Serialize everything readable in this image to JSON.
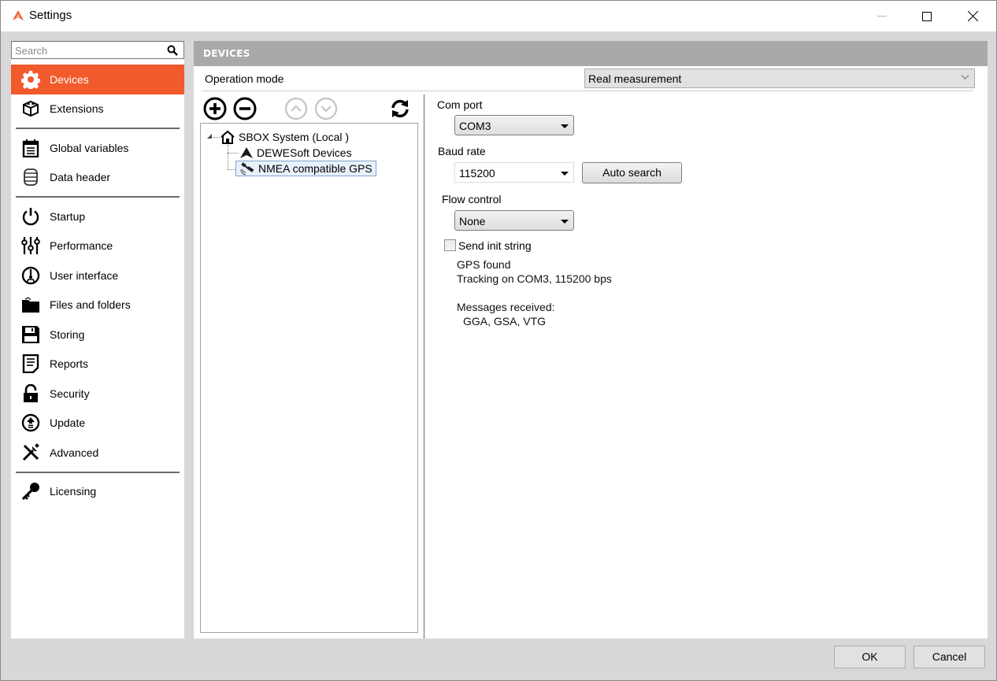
{
  "window": {
    "title": "Settings",
    "controls": {
      "minimize": "minimize",
      "maximize": "maximize",
      "close": "close"
    }
  },
  "sidebar": {
    "search": {
      "placeholder": "Search",
      "value": ""
    },
    "groups": [
      [
        {
          "label": "Devices",
          "icon": "gear-icon",
          "active": true
        },
        {
          "label": "Extensions",
          "icon": "lego-box-icon",
          "active": false
        }
      ],
      [
        {
          "label": "Global variables",
          "icon": "clipboard-icon",
          "active": false
        },
        {
          "label": "Data header",
          "icon": "database-icon",
          "active": false
        }
      ],
      [
        {
          "label": "Startup",
          "icon": "power-icon",
          "active": false
        },
        {
          "label": "Performance",
          "icon": "sliders-icon",
          "active": false
        },
        {
          "label": "User interface",
          "icon": "gauge-icon",
          "active": false
        },
        {
          "label": "Files and folders",
          "icon": "folder-icon",
          "active": false
        },
        {
          "label": "Storing",
          "icon": "floppy-disk-icon",
          "active": false
        },
        {
          "label": "Reports",
          "icon": "document-icon",
          "active": false
        },
        {
          "label": "Security",
          "icon": "lock-icon",
          "active": false
        },
        {
          "label": "Update",
          "icon": "upload-circle-icon",
          "active": false
        },
        {
          "label": "Advanced",
          "icon": "tools-icon",
          "active": false
        }
      ],
      [
        {
          "label": "Licensing",
          "icon": "key-icon",
          "active": false
        }
      ]
    ]
  },
  "main": {
    "section_title": "DEVICES",
    "operation_mode": {
      "label": "Operation mode",
      "value": "Real measurement"
    },
    "toolbar": {
      "add": "add-device",
      "remove": "remove-device",
      "move_up": "move-up",
      "move_down": "move-down",
      "refresh": "refresh"
    },
    "tree": {
      "root": {
        "label": "SBOX System (Local )",
        "icon": "home-icon",
        "expanded": true
      },
      "children": [
        {
          "label": "DEWESoft Devices",
          "icon": "dewesoft-logo-icon",
          "selected": false
        },
        {
          "label": "NMEA compatible GPS",
          "icon": "satellite-icon",
          "selected": true
        }
      ]
    },
    "device_settings": {
      "com_port": {
        "label": "Com port",
        "value": "COM3"
      },
      "baud_rate": {
        "label": "Baud rate",
        "value": "115200"
      },
      "auto_search_label": "Auto search",
      "flow_control": {
        "label": "Flow control",
        "value": "None"
      },
      "send_init_string": {
        "label": "Send init string",
        "checked": false
      },
      "status": {
        "line1": "GPS found",
        "line2": "Tracking on COM3, 115200 bps",
        "messages_label": "Messages received:",
        "messages": "GGA, GSA, VTG"
      }
    }
  },
  "footer": {
    "ok_label": "OK",
    "cancel_label": "Cancel"
  },
  "colors": {
    "accent": "#f15a2b",
    "header_bg": "#a9a9a9",
    "window_bg": "#d9d7da"
  }
}
